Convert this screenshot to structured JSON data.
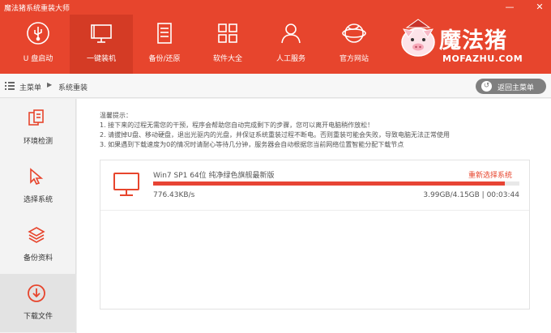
{
  "window": {
    "title": "魔法猪系统重装大师",
    "minimize": "—",
    "close": "✕"
  },
  "nav": {
    "items": [
      {
        "label": "U 盘启动",
        "icon": "usb-icon"
      },
      {
        "label": "一键装机",
        "icon": "monitor-icon",
        "active": true
      },
      {
        "label": "备份/还原",
        "icon": "server-icon"
      },
      {
        "label": "软件大全",
        "icon": "grid-icon"
      },
      {
        "label": "人工服务",
        "icon": "person-icon"
      },
      {
        "label": "官方网站",
        "icon": "globe-icon"
      }
    ]
  },
  "logo": {
    "cn": "魔法猪",
    "en": "MOFAZHU.COM"
  },
  "breadcrumb": {
    "root": "主菜单",
    "separator": "▶",
    "current": "系统重装"
  },
  "back_button": {
    "label": "返回主菜单"
  },
  "sidebar": {
    "items": [
      {
        "label": "环境检测",
        "icon": "check-env-icon"
      },
      {
        "label": "选择系统",
        "icon": "cursor-icon"
      },
      {
        "label": "备份资料",
        "icon": "layers-icon"
      },
      {
        "label": "下载文件",
        "icon": "download-icon",
        "active": true
      }
    ]
  },
  "tips": {
    "heading": "温馨提示：",
    "lines": [
      "1. 接下来的过程无需您的干预，程序会帮助您自动完成剩下的步骤，您可以离开电脑稍作放松！",
      "2. 请拔掉U盘、移动硬盘，退出光驱内的光盘，并保证系统重装过程不断电。否则重装可能会失败，导致电脑无法正常使用",
      "3. 如果遇到下载速度为0的情况时请耐心等待几分钟，服务器会自动根据您当前网络位置智能分配下载节点"
    ]
  },
  "download": {
    "name": "Win7 SP1 64位 纯净绿色旗舰最新版",
    "reselect_label": "重新选择系统",
    "speed": "776.43KB/s",
    "size": "3.99GB/4.15GB | 00:03:44",
    "progress": 0.96
  },
  "colors": {
    "accent": "#e7452d",
    "progress": "#e74434"
  }
}
